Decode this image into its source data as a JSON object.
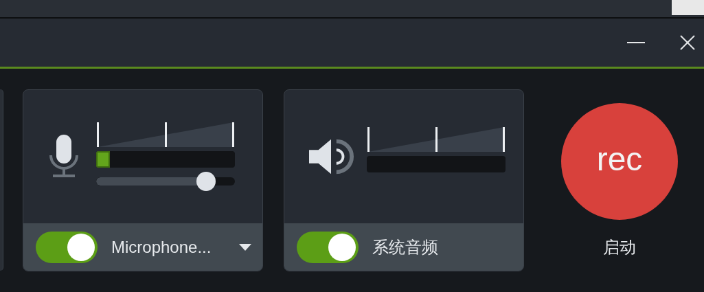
{
  "sources": [
    {
      "kind": "microphone",
      "meter": {
        "level": 0.1
      },
      "volume": {
        "level": 0.79
      },
      "on": true,
      "label": "Microphone...",
      "dropdown": true
    },
    {
      "kind": "speaker",
      "meter": {
        "level": 0
      },
      "on": true,
      "label": "系统音频",
      "dropdown": false
    }
  ],
  "record_button": {
    "text": "rec",
    "label": "启动"
  }
}
